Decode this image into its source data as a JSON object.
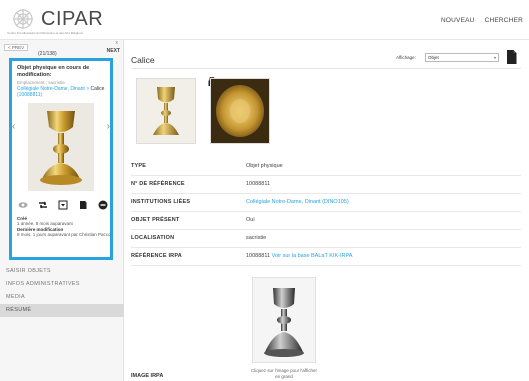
{
  "header": {
    "logo_text": "CIPAR",
    "logo_subtitle": "Centre Interdiocésain du Patrimoine et des Arts Religieux",
    "nav": [
      "NOUVEAU",
      "CHERCHER"
    ]
  },
  "pager": {
    "prev_label": "< PREV",
    "count": "(21/138)",
    "next_label": "NEXT",
    "close": "x"
  },
  "card": {
    "title": "Objet physique en cours de modification:",
    "subtitle": "Emplacement : sacristie",
    "link_text": "Collégiale Notre-Dame, Dinant >",
    "link_object": "Calice",
    "link_ref": "(10088811)",
    "created_label": "Créé",
    "created_value": "1 année, 8 mois auparavant",
    "modified_label": "Dernière modification",
    "modified_value": "8 mois, 1 jours auparavant par Christian Pacco"
  },
  "left_menu": [
    "SAISIR OBJETS",
    "INFOS ADMINISTRATIVES",
    "MEDIA",
    "RÉSUMÉ"
  ],
  "main": {
    "title": "Calice",
    "affichage_label": "Affichage:",
    "affichage_value": "Objet",
    "properties": [
      {
        "key": "TYPE",
        "value": "Objet physique"
      },
      {
        "key": "N° DE RÉFÉRENCE",
        "value": "10088811"
      },
      {
        "key": "INSTITUTIONS LIÉES",
        "value": "Collégiale Notre-Dame, Dinant (DINO105)"
      },
      {
        "key": "OBJET PRÉSENT",
        "value": "Oui"
      },
      {
        "key": "LOCALISATION",
        "value": "sacristie"
      },
      {
        "key": "RÉFÉRENCE IRPA",
        "value": "10088811",
        "link": "Voir sur la base BALaT KIK-IRPA"
      }
    ],
    "irpa_label": "IMAGE IRPA",
    "irpa_caption": "Cliquez sur l'image pour l'afficher en grand"
  },
  "colors": {
    "accent": "#29a3de",
    "menu_active": "#d9d9d9"
  }
}
